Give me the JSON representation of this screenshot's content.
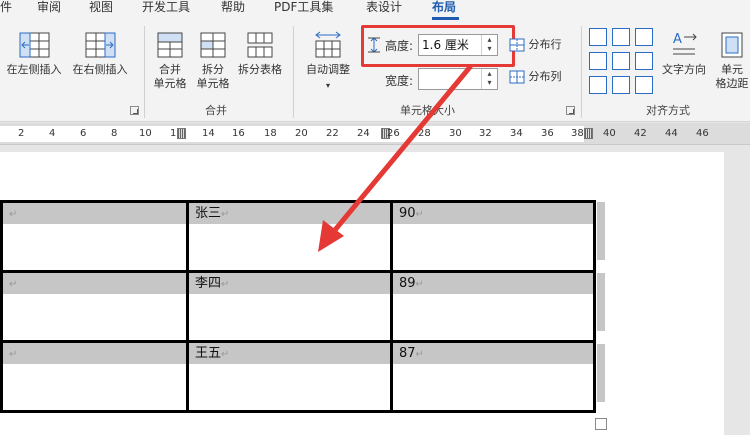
{
  "tabs": [
    "件",
    "审阅",
    "视图",
    "开发工具",
    "帮助",
    "PDF工具集",
    "表设计",
    "布局"
  ],
  "ribbon": {
    "insert_left": "在左侧插入",
    "insert_right": "在右侧插入",
    "merge_cells_line1": "合并",
    "merge_cells_line2": "单元格",
    "split_cells_line1": "拆分",
    "split_cells_line2": "单元格",
    "split_table": "拆分表格",
    "merge_group": "合并",
    "autofit": "自动调整",
    "height_label": "高度:",
    "height_value": "1.6 厘米",
    "width_label": "宽度:",
    "width_value": "",
    "distribute_rows": "分布行",
    "distribute_cols": "分布列",
    "cell_size_group": "单元格大小",
    "text_direction": "文字方向",
    "cell_margins_line1": "单元",
    "cell_margins_line2": "格边距",
    "alignment_group": "对齐方式"
  },
  "ruler": {
    "ticks": [
      "2",
      "4",
      "6",
      "8",
      "10",
      "12",
      "14",
      "16",
      "18",
      "20",
      "22",
      "24",
      "26",
      "28",
      "30",
      "32",
      "34",
      "36",
      "38",
      "40",
      "42",
      "44",
      "46"
    ]
  },
  "table": {
    "rows": [
      [
        "",
        "张三",
        "90"
      ],
      [
        "",
        "李四",
        "89"
      ],
      [
        "",
        "王五",
        "87"
      ]
    ],
    "paragraph_mark": "↵"
  },
  "highlight_color": "#e53935"
}
